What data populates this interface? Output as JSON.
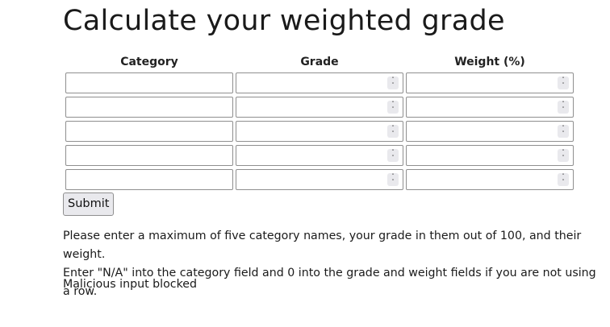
{
  "page": {
    "title": "Calculate your weighted grade"
  },
  "table": {
    "headers": [
      "Category",
      "Grade",
      "Weight (%)"
    ],
    "rows": [
      {
        "category": "",
        "grade": "",
        "weight": ""
      },
      {
        "category": "",
        "grade": "",
        "weight": ""
      },
      {
        "category": "",
        "grade": "",
        "weight": ""
      },
      {
        "category": "",
        "grade": "",
        "weight": ""
      },
      {
        "category": "",
        "grade": "",
        "weight": ""
      }
    ]
  },
  "form": {
    "submit_label": "Submit"
  },
  "instructions": {
    "line1": "Please enter a maximum of five category names, your grade in them out of 100, and their weight.",
    "line2": "Enter \"N/A\" into the category field and 0 into the grade and weight fields if you are not using a row."
  },
  "status": {
    "message": "Malicious input blocked"
  },
  "icons": {
    "spinner": "up-down-chevron-icon"
  }
}
